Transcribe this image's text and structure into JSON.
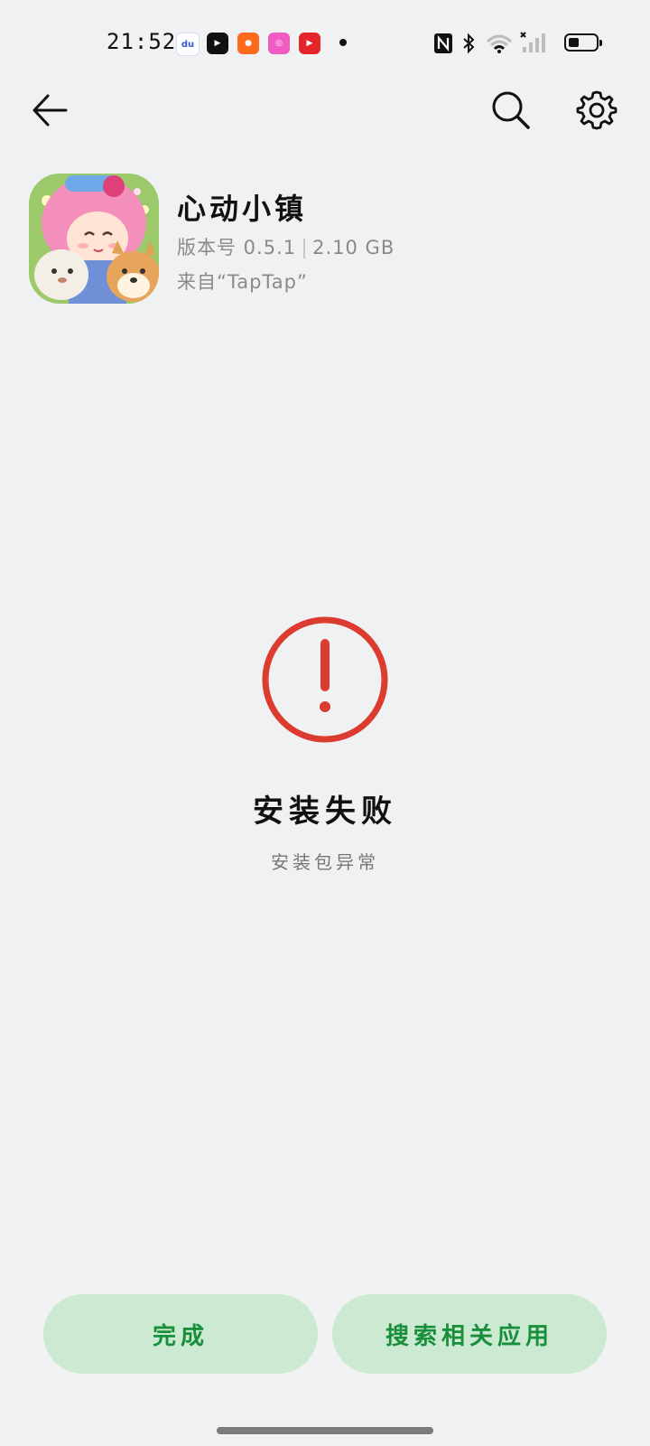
{
  "status_bar": {
    "time": "21:52",
    "notification_icons": [
      "baidu-app-icon",
      "douyin-app-icon",
      "kuaishou-app-icon",
      "camera-app-icon",
      "video-app-icon"
    ],
    "system_icons": [
      "nfc-icon",
      "bluetooth-icon",
      "wifi-icon",
      "signal-icon",
      "battery-icon"
    ],
    "battery_level": 0.3
  },
  "toolbar": {
    "back_icon": "arrow-left-icon",
    "search_icon": "search-icon",
    "settings_icon": "gear-icon"
  },
  "app": {
    "name": "心动小镇",
    "version_label": "版本号 0.5.1",
    "size": "2.10 GB",
    "source": "来自“TapTap”"
  },
  "result": {
    "title": "安装失败",
    "subtitle": "安装包异常",
    "icon": "alert-circle-icon",
    "icon_color": "#dc3b2f"
  },
  "actions": {
    "done_label": "完成",
    "search_related_label": "搜索相关应用",
    "accent_bg": "#cce9d2",
    "accent_text": "#1a8f3b"
  }
}
